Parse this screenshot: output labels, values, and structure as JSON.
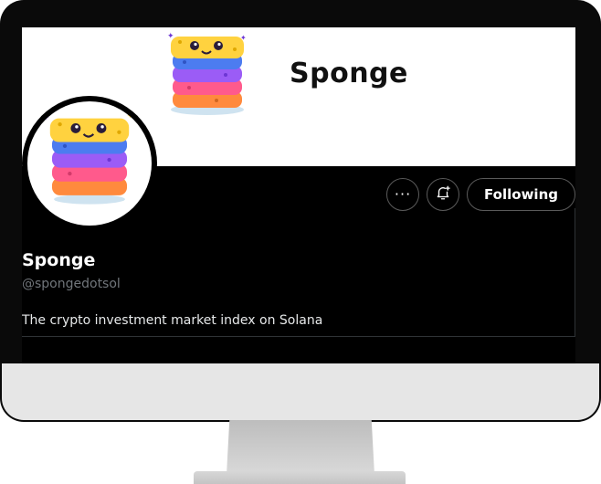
{
  "profile": {
    "banner_title": "Sponge",
    "display_name": "Sponge",
    "handle": "@spongedotsol",
    "bio": "The crypto investment market index on Solana"
  },
  "actions": {
    "more_icon": "more-icon",
    "notify_icon": "bell-plus-icon",
    "follow_label": "Following"
  },
  "colors": {
    "screen_bg": "#000000",
    "banner_bg": "#ffffff",
    "text_primary": "#ffffff",
    "text_secondary": "#71767b",
    "border": "#5a5a5a"
  }
}
